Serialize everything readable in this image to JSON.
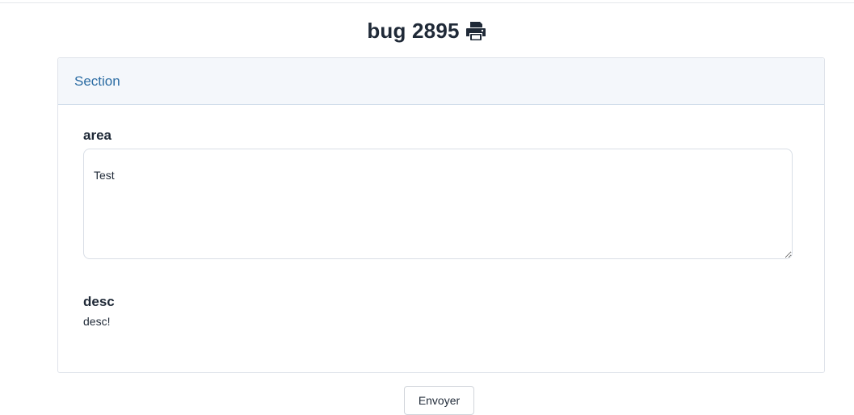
{
  "page": {
    "title": "bug 2895",
    "print_icon": "print-icon"
  },
  "section": {
    "title": "Section",
    "fields": {
      "area": {
        "label": "area",
        "value": "Test"
      },
      "desc": {
        "label": "desc",
        "value": "desc!"
      }
    }
  },
  "actions": {
    "submit_label": "Envoyer"
  },
  "colors": {
    "section_title": "#2b6ca3",
    "section_header_bg": "#f4f7fb",
    "text": "#1f2937"
  }
}
